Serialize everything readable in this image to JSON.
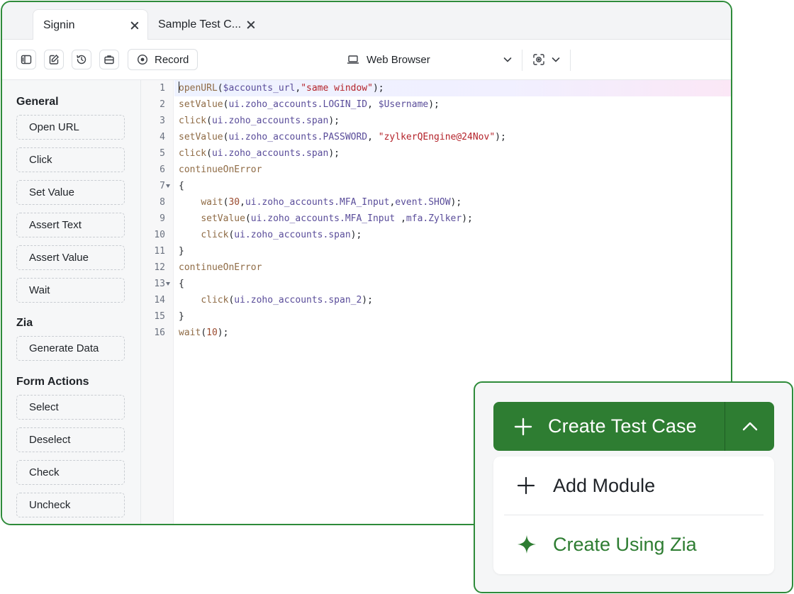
{
  "tabs": [
    {
      "label": "Signin",
      "active": true
    },
    {
      "label": "Sample Test C...",
      "active": false
    }
  ],
  "toolbar": {
    "record_label": "Record",
    "browser_label": "Web Browser",
    "icons": [
      "panel-toggle-icon",
      "edit-icon",
      "history-icon",
      "briefcase-icon",
      "record-icon",
      "laptop-icon",
      "zia-scan-icon"
    ]
  },
  "sidebar": {
    "sections": [
      {
        "title": "General",
        "items": [
          "Open URL",
          "Click",
          "Set Value",
          "Assert Text",
          "Assert Value",
          "Wait"
        ]
      },
      {
        "title": "Zia",
        "items": [
          "Generate Data"
        ]
      },
      {
        "title": "Form Actions",
        "items": [
          "Select",
          "Deselect",
          "Check",
          "Uncheck"
        ]
      }
    ]
  },
  "editor": {
    "line_numbers": [
      "1",
      "2",
      "3",
      "4",
      "5",
      "6",
      "7",
      "8",
      "9",
      "10",
      "11",
      "12",
      "13",
      "14",
      "15",
      "16"
    ],
    "lines": [
      "openURL($accounts_url,\"same window\");",
      "setValue(ui.zoho_accounts.LOGIN_ID, $Username);",
      "click(ui.zoho_accounts.span);",
      "setValue(ui.zoho_accounts.PASSWORD, \"zylkerQEngine@24Nov\");",
      "click(ui.zoho_accounts.span);",
      "continueOnError",
      "{",
      "    wait(30,ui.zoho_accounts.MFA_Input,event.SHOW);",
      "    setValue(ui.zoho_accounts.MFA_Input ,mfa.Zylker);",
      "    click(ui.zoho_accounts.span);",
      "}",
      "continueOnError",
      "{",
      "    click(ui.zoho_accounts.span_2);",
      "}",
      "wait(10);"
    ]
  },
  "dropdown": {
    "primary_label": "Create Test Case",
    "items": [
      {
        "label": "Add Module",
        "icon": "plus-icon"
      },
      {
        "label": "Create Using Zia",
        "icon": "sparkle-icon"
      }
    ]
  },
  "colors": {
    "accent_green": "#2e7d32",
    "border_green": "#2e8b3a",
    "string_red": "#b4232a",
    "function_brown": "#8f6b45",
    "identifier_purple": "#5a4d9a"
  }
}
